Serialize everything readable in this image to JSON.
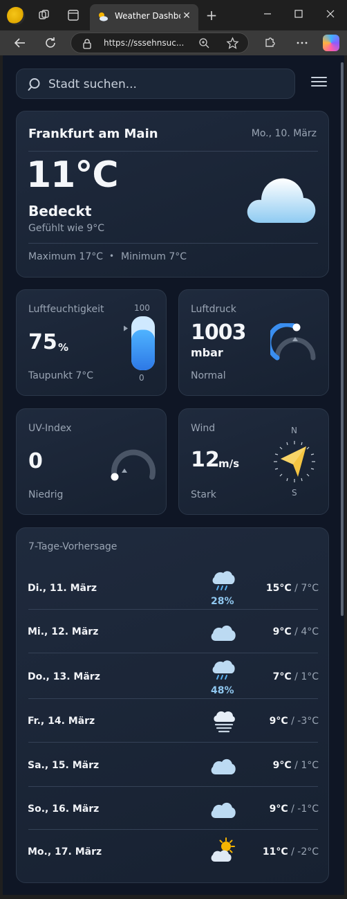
{
  "browser": {
    "tab_title": "Weather Dashboard",
    "url": "https://sssehnsuc...",
    "new_tab_symbol": "+"
  },
  "search": {
    "placeholder": "Stadt suchen..."
  },
  "current": {
    "city": "Frankfurt am Main",
    "date": "Mo., 10. März",
    "temperature": "11°C",
    "condition": "Bedeckt",
    "feels_like": "Gefühlt wie 9°C",
    "maximum": "Maximum 17°C",
    "separator": "•",
    "minimum": "Minimum 7°C",
    "icon": "cloud-icon"
  },
  "humidity": {
    "label": "Luftfeuchtigkeit",
    "value": "75",
    "unit": "%",
    "dew_point": "Taupunkt 7°C",
    "scale_max": "100",
    "scale_min": "0",
    "level_percent": 75
  },
  "pressure": {
    "label": "Luftdruck",
    "value": "1003",
    "unit": "mbar",
    "status": "Normal"
  },
  "uv": {
    "label": "UV-Index",
    "value": "0",
    "status": "Niedrig"
  },
  "wind": {
    "label": "Wind",
    "value": "12",
    "unit": "m/s",
    "status": "Stark",
    "north": "N",
    "south": "S"
  },
  "forecast": {
    "title": "7-Tage-Vorhersage",
    "days": [
      {
        "day": "Di., 11. März",
        "icon": "rain-cloud-icon",
        "precip": "28%",
        "high": "15°C",
        "sep": " / ",
        "low": "7°C"
      },
      {
        "day": "Mi., 12. März",
        "icon": "cloud-icon",
        "precip": "",
        "high": "9°C",
        "sep": " / ",
        "low": "4°C"
      },
      {
        "day": "Do., 13. März",
        "icon": "rain-cloud-icon",
        "precip": "48%",
        "high": "7°C",
        "sep": " / ",
        "low": "1°C"
      },
      {
        "day": "Fr., 14. März",
        "icon": "fog-icon",
        "precip": "",
        "high": "9°C",
        "sep": " / ",
        "low": "-3°C"
      },
      {
        "day": "Sa., 15. März",
        "icon": "cloud-icon",
        "precip": "",
        "high": "9°C",
        "sep": " / ",
        "low": "1°C"
      },
      {
        "day": "So., 16. März",
        "icon": "cloud-icon",
        "precip": "",
        "high": "9°C",
        "sep": " / ",
        "low": "-1°C"
      },
      {
        "day": "Mo., 17. März",
        "icon": "sun-cloud-icon",
        "precip": "",
        "high": "11°C",
        "sep": " / ",
        "low": "-2°C"
      }
    ]
  },
  "colors": {
    "background": "#0f1625",
    "card": "#1c2639",
    "accent_blue": "#3a8ef0",
    "wind_arrow": "#f5c542",
    "precip": "#8fc7ef"
  }
}
